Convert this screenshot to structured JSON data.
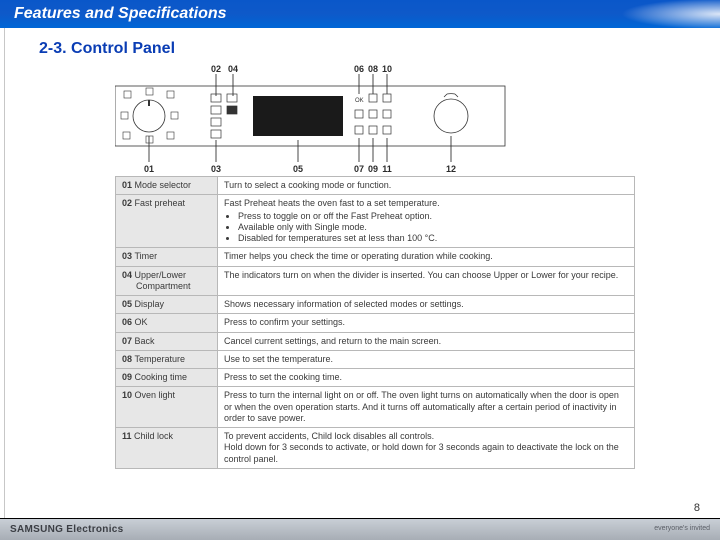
{
  "header": {
    "title": "Features and Specifications"
  },
  "section": {
    "title": "2-3. Control Panel"
  },
  "callouts": {
    "top": {
      "c02": "02",
      "c04": "04",
      "c06": "06",
      "c08": "08",
      "c10": "10"
    },
    "bottom": {
      "c01": "01",
      "c03": "03",
      "c05": "05",
      "c07": "07",
      "c09": "09",
      "c11": "11",
      "c12": "12"
    }
  },
  "rows": [
    {
      "num": "01",
      "name": "Mode selector",
      "desc": "Turn to select a cooking mode or function."
    },
    {
      "num": "02",
      "name": "Fast preheat",
      "desc": "Fast Preheat heats the oven fast to a set temperature.",
      "bullets": [
        "Press to toggle on or off the Fast Preheat option.",
        "Available only with Single mode.",
        "Disabled for temperatures set at less than 100 °C."
      ]
    },
    {
      "num": "03",
      "name": "Timer",
      "desc": "Timer helps you check the time or operating duration while cooking."
    },
    {
      "num": "04",
      "name": "Upper/Lower Compartment",
      "desc": "The indicators turn on when the divider is inserted. You can choose Upper or Lower for your recipe."
    },
    {
      "num": "05",
      "name": "Display",
      "desc": "Shows necessary information of selected modes or settings."
    },
    {
      "num": "06",
      "name": "OK",
      "desc": "Press to confirm your settings."
    },
    {
      "num": "07",
      "name": "Back",
      "desc": "Cancel current settings, and return to the main screen."
    },
    {
      "num": "08",
      "name": "Temperature",
      "desc": "Use to set the temperature."
    },
    {
      "num": "09",
      "name": "Cooking time",
      "desc": "Press to set the cooking time."
    },
    {
      "num": "10",
      "name": "Oven light",
      "desc": "Press to turn the internal light on or off. The oven light turns on automatically when the door is open or when the oven operation starts. And it turns off automatically after a certain period of inactivity in order to save power."
    },
    {
      "num": "11",
      "name": "Child lock",
      "desc": "To prevent accidents, Child lock disables all controls.\nHold down for 3 seconds to activate, or hold down for 3 seconds again to deactivate the lock on the control panel."
    }
  ],
  "page_number": "8",
  "footer": {
    "brand": "SAMSUNG Electronics",
    "tagline": "everyone's invited"
  }
}
